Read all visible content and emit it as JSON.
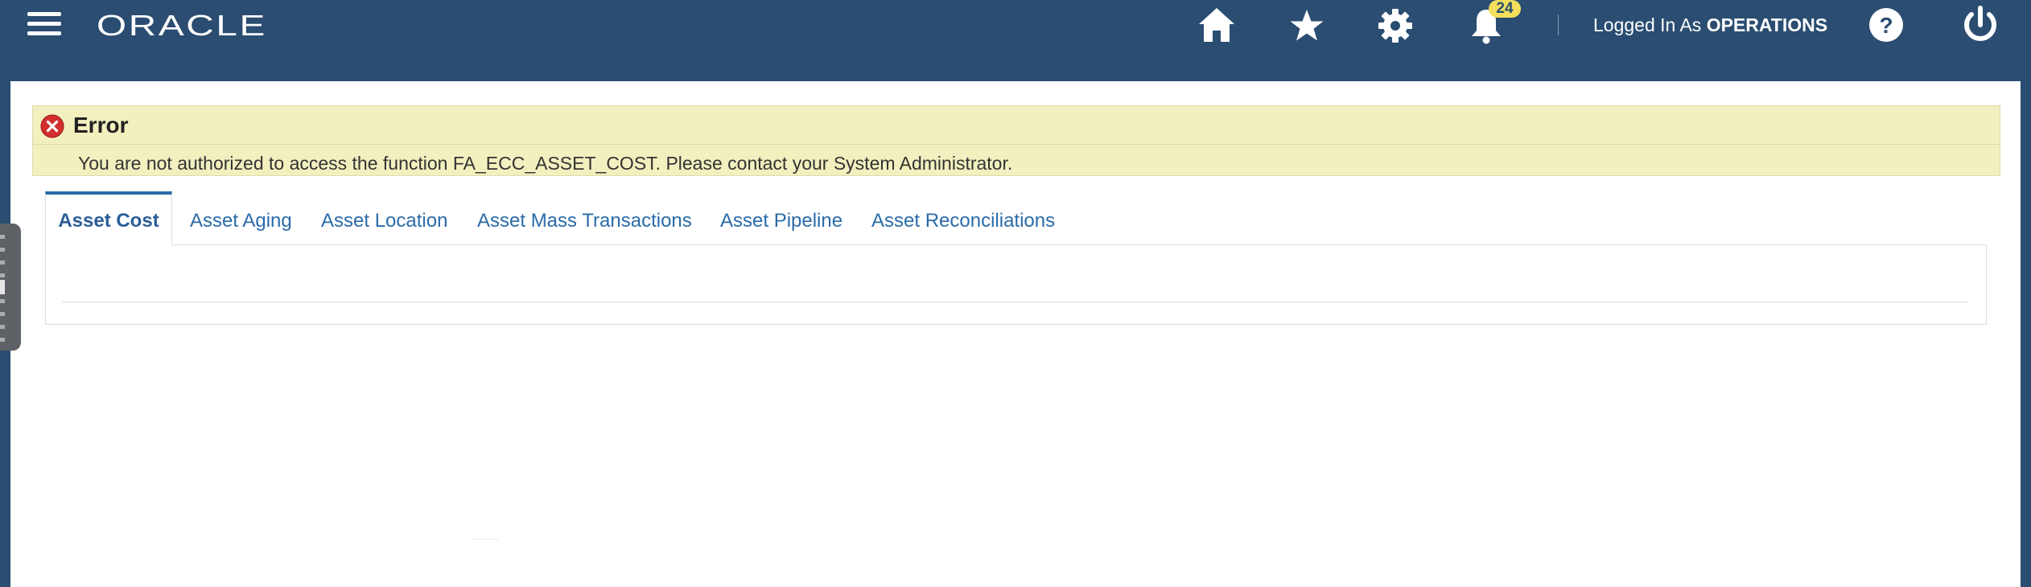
{
  "header": {
    "logo_text": "ORACLE",
    "notifications_count": "24",
    "logged_in_prefix": "Logged In As",
    "logged_in_user": "OPERATIONS",
    "icons": [
      "hamburger-menu-icon",
      "home-icon",
      "favorites-star-icon",
      "settings-gear-icon",
      "notifications-bell-icon",
      "help-icon",
      "power-icon"
    ]
  },
  "error": {
    "title": "Error",
    "message": "You are not authorized to access the function FA_ECC_ASSET_COST. Please contact your System Administrator."
  },
  "tabs": [
    {
      "label": "Asset Cost",
      "active": true
    },
    {
      "label": "Asset Aging",
      "active": false
    },
    {
      "label": "Asset Location",
      "active": false
    },
    {
      "label": "Asset Mass Transactions",
      "active": false
    },
    {
      "label": "Asset Pipeline",
      "active": false
    },
    {
      "label": "Asset Reconciliations",
      "active": false
    }
  ],
  "colors": {
    "header_bg": "#2a4d71",
    "badge_bg": "#f3df5b",
    "error_bg": "#f2f0bf",
    "error_icon": "#d32f2f",
    "tab_link": "#2a6ba9"
  }
}
